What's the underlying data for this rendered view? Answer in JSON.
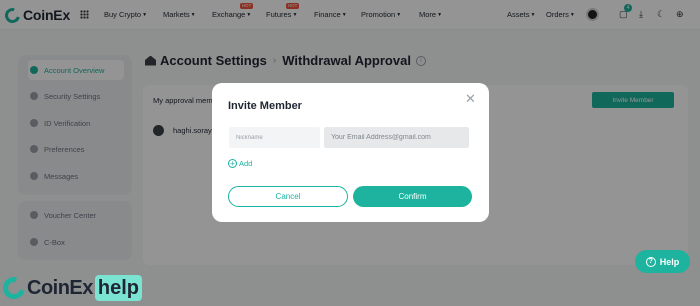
{
  "brand": {
    "name": "CoinEx",
    "accent": "#1db39e"
  },
  "topnav": {
    "items": [
      {
        "label": "Buy Crypto",
        "hot": ""
      },
      {
        "label": "Markets",
        "hot": ""
      },
      {
        "label": "Exchange",
        "hot": "HOT"
      },
      {
        "label": "Futures",
        "hot": "HOT"
      },
      {
        "label": "Finance",
        "hot": ""
      },
      {
        "label": "Promotion",
        "hot": ""
      },
      {
        "label": "More",
        "hot": ""
      }
    ],
    "assets_label": "Assets",
    "orders_label": "Orders",
    "notification_count": "4"
  },
  "sidebar": {
    "items": [
      {
        "label": "Account Overview",
        "active": true
      },
      {
        "label": "Security Settings",
        "active": false
      },
      {
        "label": "ID Verification",
        "active": false
      },
      {
        "label": "Preferences",
        "active": false
      },
      {
        "label": "Messages",
        "active": false
      }
    ],
    "items2": [
      {
        "label": "Voucher Center"
      },
      {
        "label": "C-Box"
      }
    ]
  },
  "page": {
    "title": "Account Settings",
    "subtitle": "Withdrawal Approval",
    "panel_label": "My approval mem",
    "invite_button": "Invite Member",
    "member_name": "haghi.soray"
  },
  "modal": {
    "title": "Invite Member",
    "nickname_placeholder": "Nickname",
    "email_placeholder": "Your Email Address@gmail.com",
    "add_label": "Add",
    "cancel_label": "Cancel",
    "confirm_label": "Confirm"
  },
  "help": {
    "label": "Help"
  },
  "watermark": {
    "text": "CoinEx",
    "tag": "help"
  }
}
